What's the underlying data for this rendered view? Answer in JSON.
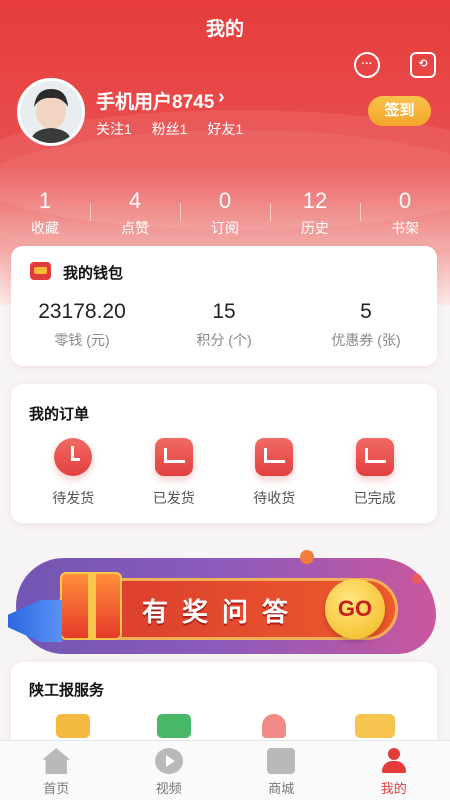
{
  "header": {
    "title": "我的",
    "message_icon": "message-bubble-icon",
    "settings_icon": "settings-hexagon-icon",
    "username": "手机用户8745",
    "chevron": "›",
    "follow": "关注1",
    "fans": "粉丝1",
    "friends": "好友1",
    "signin_label": "签到"
  },
  "stats": [
    {
      "num": "1",
      "label": "收藏"
    },
    {
      "num": "4",
      "label": "点赞"
    },
    {
      "num": "0",
      "label": "订阅"
    },
    {
      "num": "12",
      "label": "历史"
    },
    {
      "num": "0",
      "label": "书架"
    }
  ],
  "wallet": {
    "title": "我的钱包",
    "items": [
      {
        "value": "23178.20",
        "label": "零钱 (元)"
      },
      {
        "value": "15",
        "label": "积分 (个)"
      },
      {
        "value": "5",
        "label": "优惠券 (张)"
      }
    ]
  },
  "orders": {
    "title": "我的订单",
    "items": [
      {
        "label": "待发货",
        "icon": "clock-icon"
      },
      {
        "label": "已发货",
        "icon": "truck-icon"
      },
      {
        "label": "待收货",
        "icon": "shopping-bag-icon"
      },
      {
        "label": "已完成",
        "icon": "box-check-icon"
      }
    ]
  },
  "banner": {
    "text": "有奖问答",
    "go": "GO"
  },
  "services": {
    "title": "陕工报服务",
    "icon_colors": [
      "#f4b941",
      "#49b768",
      "#f08a86",
      "#f6c44f"
    ]
  },
  "tabbar": [
    {
      "label": "首页",
      "icon": "home-icon"
    },
    {
      "label": "视频",
      "icon": "video-play-icon"
    },
    {
      "label": "商城",
      "icon": "shopping-bag-icon"
    },
    {
      "label": "我的",
      "icon": "user-icon"
    }
  ],
  "colors": {
    "primary": "#e33a3a",
    "accent": "#f5b22f"
  }
}
